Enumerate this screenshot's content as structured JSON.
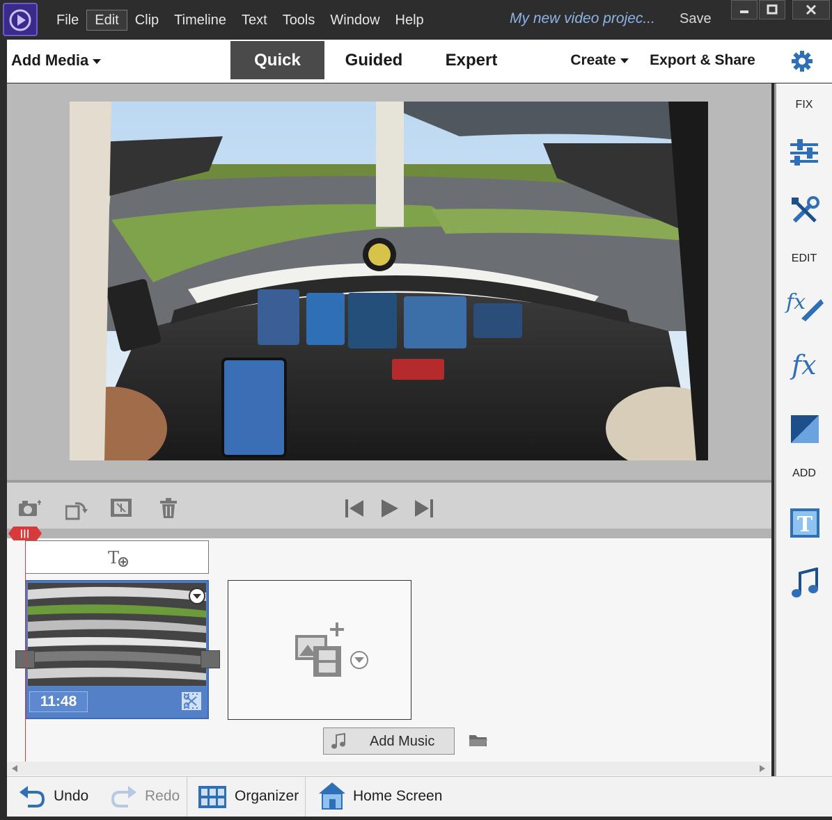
{
  "menu": {
    "items": [
      "File",
      "Edit",
      "Clip",
      "Timeline",
      "Text",
      "Tools",
      "Window",
      "Help"
    ],
    "active": "Edit"
  },
  "project_title": "My new video projec...",
  "save_label": "Save",
  "modebar": {
    "add_media": "Add Media",
    "tabs": [
      "Quick",
      "Guided",
      "Expert"
    ],
    "active_tab": "Quick",
    "create": "Create",
    "export_share": "Export & Share"
  },
  "right_panel": {
    "fix_heading": "FIX",
    "edit_heading": "EDIT",
    "add_heading": "ADD",
    "icons": [
      "adjustments-icon",
      "tools-icon",
      "fx-edit-icon",
      "fx-icon",
      "transition-icon",
      "title-text-icon",
      "music-icon"
    ]
  },
  "timeline": {
    "clip_duration": "11:48",
    "add_music": "Add Music"
  },
  "bottom": {
    "undo": "Undo",
    "redo": "Redo",
    "organizer": "Organizer",
    "home_screen": "Home Screen"
  },
  "colors": {
    "accent_blue": "#5380c6",
    "playhead_red": "#d63a3a",
    "project_title": "#8db4e8",
    "icon_blue": "#2f6fb5"
  }
}
